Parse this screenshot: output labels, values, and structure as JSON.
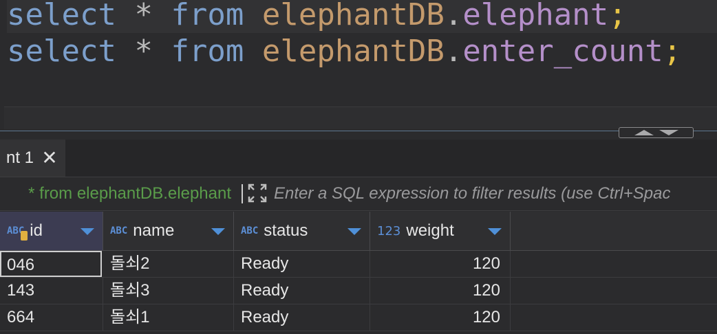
{
  "editor": {
    "lines": [
      {
        "kw1": "select",
        "op": " * ",
        "kw2": "from",
        "schema": "elephantDB",
        "dot": ".",
        "table": "elephant",
        "semi": ";"
      },
      {
        "kw1": "select",
        "op": " * ",
        "kw2": "from",
        "schema": "elephantDB",
        "dot": ".",
        "table": "enter_count",
        "semi": ";"
      }
    ]
  },
  "results": {
    "tab_label": "nt 1",
    "close_icon": "close-icon",
    "filter_query": "* from elephantDB.elephant",
    "filter_placeholder": "Enter a SQL expression to filter results (use Ctrl+Spac",
    "columns": [
      {
        "type": "ABC",
        "name": "id"
      },
      {
        "type": "ABC",
        "name": "name"
      },
      {
        "type": "ABC",
        "name": "status"
      },
      {
        "type": "123",
        "name": "weight"
      }
    ],
    "rows": [
      [
        "046",
        "돌쇠2",
        "Ready",
        "120"
      ],
      [
        "143",
        "돌쇠3",
        "Ready",
        "120"
      ],
      [
        "664",
        "돌쇠1",
        "Ready",
        "120"
      ]
    ]
  },
  "colors": {
    "keyword": "#7c9fcb",
    "identifier": "#c49a6c",
    "table": "#b48fc9",
    "filter_text": "#5a9c4a",
    "accent": "#4f90d8"
  }
}
